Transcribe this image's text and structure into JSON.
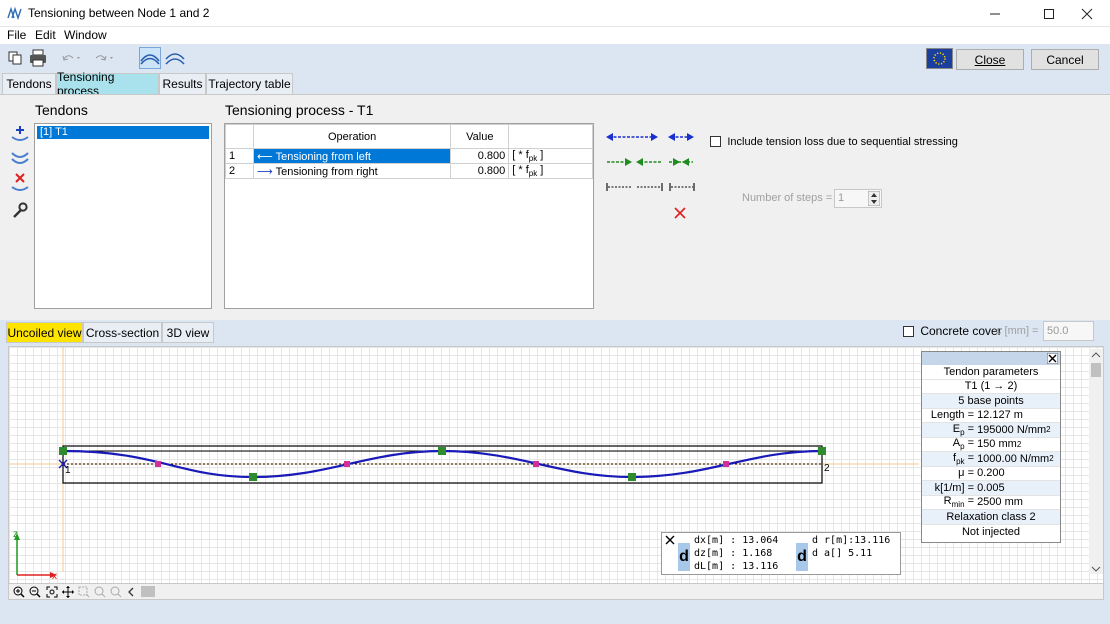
{
  "window": {
    "title": "Tensioning between Node 1 and 2"
  },
  "menu": [
    "File",
    "Edit",
    "Window"
  ],
  "toolbar": {
    "close_label": "Close",
    "cancel_label": "Cancel"
  },
  "tabs": [
    "Tendons",
    "Tensioning process",
    "Results",
    "Trajectory table"
  ],
  "tendons": {
    "heading": "Tendons",
    "items": [
      "[1] T1"
    ]
  },
  "process": {
    "heading": "Tensioning process - T1",
    "col_operation": "Operation",
    "col_value": "Value",
    "rows": [
      {
        "num": "1",
        "arrow": "⟵",
        "operation": "Tensioning from left",
        "value": "0.800",
        "unit": "[ * f",
        "unit_sub": "pk",
        "unit_end": " ]"
      },
      {
        "num": "2",
        "arrow": "⟶",
        "operation": "Tensioning from right",
        "value": "0.800",
        "unit": "[ * f",
        "unit_sub": "pk",
        "unit_end": " ]"
      }
    ]
  },
  "options": {
    "include_loss_label": "Include tension loss due to sequential stressing",
    "steps_label": "Number of steps =",
    "steps_value": "1"
  },
  "view_tabs": [
    "Uncoiled view",
    "Cross-section",
    "3D view"
  ],
  "concrete": {
    "label": "Concrete cover",
    "unit_label": "c [mm] =",
    "value": "50.0"
  },
  "drawing": {
    "node_left": "1",
    "node_right": "2",
    "axis_z": "z",
    "axis_x": "x"
  },
  "params": {
    "title": "Tendon parameters",
    "tendon": "T1 (1 → 2)",
    "base_points": "5 base points",
    "length": {
      "label": "Length =",
      "value": "12.127 m"
    },
    "ep": {
      "label": "E",
      "sub": "p",
      "eq": " =",
      "value": "195000 N/mm",
      "sup": "2"
    },
    "ap": {
      "label": "A",
      "sub": "p",
      "eq": " =",
      "value": "150 mm",
      "sup": "2"
    },
    "fpk": {
      "label": "f",
      "sub": "pk",
      "eq": " =",
      "value": "1000.00 N/mm",
      "sup": "2"
    },
    "mu": {
      "label": "μ =",
      "value": "0.200"
    },
    "k": {
      "label": "k[1/m] =",
      "value": "0.005"
    },
    "rmin": {
      "label": "R",
      "sub": "min",
      "eq": " =",
      "value": "2500 mm"
    },
    "relaxation": "Relaxation class 2",
    "injected": "Not injected"
  },
  "measure": {
    "d": "d",
    "dx": {
      "label": "dx[m] :",
      "value": "13.064"
    },
    "dz": {
      "label": "dz[m] :",
      "value": "1.168"
    },
    "dl": {
      "label": "dL[m] :",
      "value": "13.116"
    },
    "dr": {
      "label": "d r[m]:",
      "value": "13.116"
    },
    "da": {
      "label": "d     a[]",
      "value": "5.11"
    }
  },
  "colors": {
    "accent": "#0078d7",
    "tab_active": "#a9e2ec",
    "view_tab_active": "#ffe400",
    "tendon": "#1a1ab8",
    "node_green": "#2e8b2e",
    "node_magenta": "#d0309c"
  }
}
